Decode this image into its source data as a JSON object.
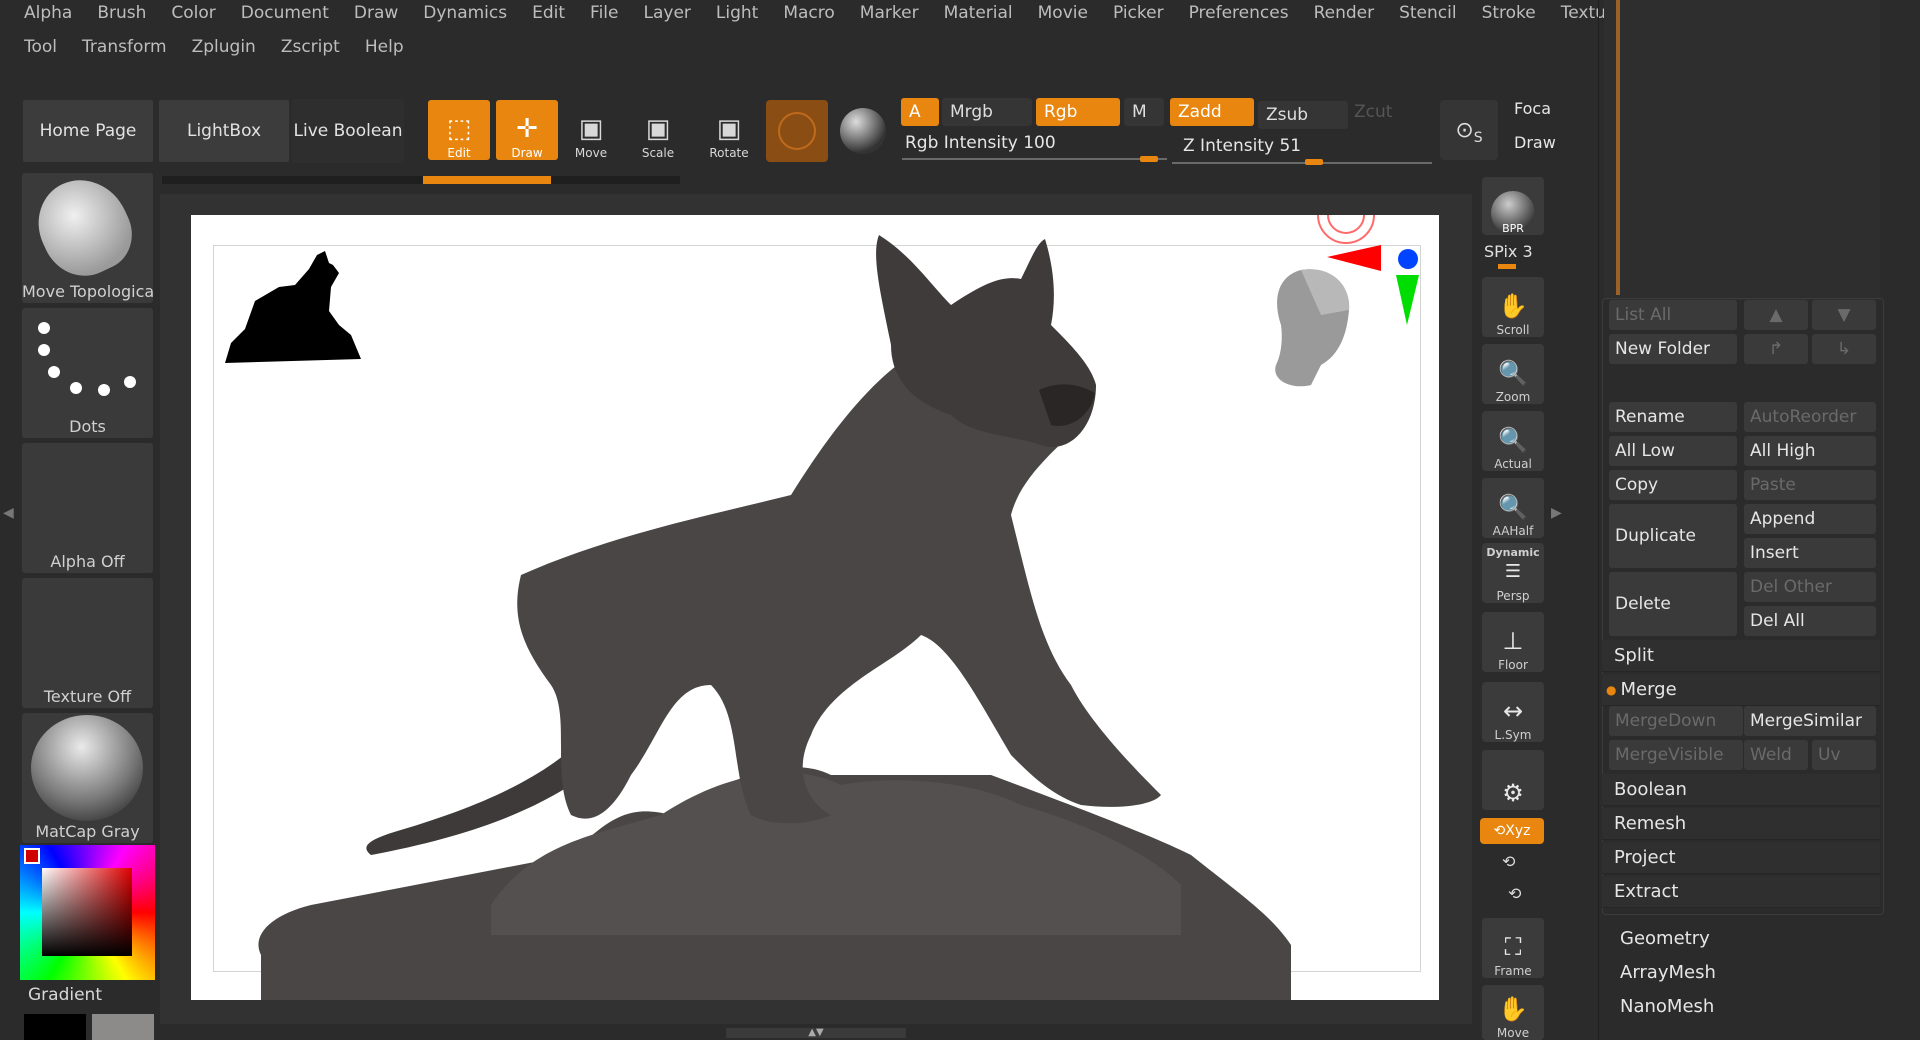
{
  "menu": {
    "row1": [
      "Alpha",
      "Brush",
      "Color",
      "Document",
      "Draw",
      "Dynamics",
      "Edit",
      "File",
      "Layer",
      "Light",
      "Macro",
      "Marker",
      "Material",
      "Movie",
      "Picker",
      "Preferences",
      "Render",
      "Stencil",
      "Stroke",
      "Texture"
    ],
    "row2": [
      "Tool",
      "Transform",
      "Zplugin",
      "Zscript",
      "Help"
    ]
  },
  "toolbar": {
    "home_page": "Home Page",
    "lightbox": "LightBox",
    "live_boolean": "Live Boolean",
    "edit": "Edit",
    "draw": "Draw",
    "move": "Move",
    "scale": "Scale",
    "rotate": "Rotate",
    "a": "A",
    "mrgb": "Mrgb",
    "rgb": "Rgb",
    "m": "M",
    "zadd": "Zadd",
    "zsub": "Zsub",
    "zcut": "Zcut",
    "rgb_intensity": "Rgb Intensity 100",
    "z_intensity": "Z Intensity 51",
    "rgb_intensity_value": 100,
    "z_intensity_value": 51,
    "focal": "Foca",
    "draw_size": "Draw",
    "sym_icon_letter": "S"
  },
  "left_shelf": {
    "brush_label": "Move Topologica",
    "stroke_label": "Dots",
    "alpha_label": "Alpha Off",
    "texture_label": "Texture Off",
    "material_label": "MatCap Gray",
    "gradient_label": "Gradient"
  },
  "dock": {
    "bpr": "BPR",
    "spix": "SPix 3",
    "scroll": "Scroll",
    "zoom": "Zoom",
    "actual": "Actual",
    "aahalf": "AAHalf",
    "dynamic": "Dynamic",
    "persp": "Persp",
    "floor": "Floor",
    "lsym": "L.Sym",
    "xyz": "Xyz",
    "frame": "Frame",
    "move": "Move"
  },
  "subtool": {
    "list_all": "List All",
    "new_folder": "New Folder",
    "rename": "Rename",
    "auto_reorder": "AutoReorder",
    "all_low": "All Low",
    "all_high": "All High",
    "copy": "Copy",
    "paste": "Paste",
    "duplicate": "Duplicate",
    "append": "Append",
    "insert": "Insert",
    "delete": "Delete",
    "del_other": "Del Other",
    "del_all": "Del All",
    "split": "Split",
    "merge": "Merge",
    "merge_down": "MergeDown",
    "merge_similar": "MergeSimilar",
    "merge_visible": "MergeVisible",
    "weld": "Weld",
    "uv": "Uv",
    "boolean": "Boolean",
    "remesh": "Remesh",
    "project": "Project",
    "extract": "Extract"
  },
  "tool_sections": [
    "Geometry",
    "ArrayMesh",
    "NanoMesh"
  ],
  "colors": {
    "accent": "#e8860f",
    "bg": "#2b2b2b",
    "canvas": "#ffffff"
  }
}
